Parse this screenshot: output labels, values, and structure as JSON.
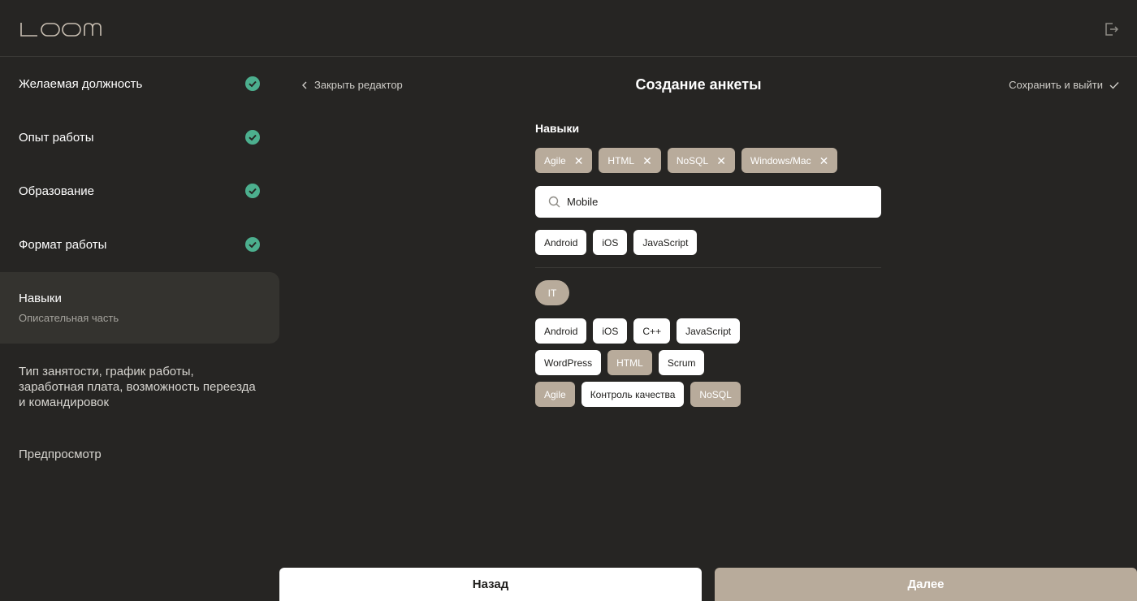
{
  "brand": {
    "logo_text": "LOOM"
  },
  "sidebar": {
    "steps": [
      {
        "label": "Желаемая должность",
        "done": true
      },
      {
        "label": "Опыт работы",
        "done": true
      },
      {
        "label": "Образование",
        "done": true
      },
      {
        "label": "Формат работы",
        "done": true
      },
      {
        "label": "Навыки",
        "sub": "Описательная часть",
        "active": true
      },
      {
        "label": "Тип занятости, график работы, заработная плата, возможность переезда и командировок"
      },
      {
        "label": "Предпросмотр"
      }
    ]
  },
  "header": {
    "close_editor": "Закрыть редактор",
    "title": "Создание анкеты",
    "save_exit": "Сохранить и выйти"
  },
  "skills": {
    "section_title": "Навыки",
    "selected": [
      "Agile",
      "HTML",
      "NoSQL",
      "Windows/Mac"
    ],
    "search": {
      "value": "Mobile",
      "placeholder": ""
    },
    "suggestions": [
      "Android",
      "iOS",
      "JavaScript"
    ],
    "category": "IT",
    "category_rows": [
      [
        {
          "label": "Android",
          "selected": false
        },
        {
          "label": "iOS",
          "selected": false
        },
        {
          "label": "C++",
          "selected": false
        },
        {
          "label": "JavaScript",
          "selected": false
        }
      ],
      [
        {
          "label": "WordPress",
          "selected": false
        },
        {
          "label": "HTML",
          "selected": true
        },
        {
          "label": "Scrum",
          "selected": false
        }
      ],
      [
        {
          "label": "Agile",
          "selected": true
        },
        {
          "label": "Контроль качества",
          "selected": false
        },
        {
          "label": "NoSQL",
          "selected": true
        }
      ]
    ]
  },
  "footer": {
    "back": "Назад",
    "next": "Далее"
  },
  "colors": {
    "background": "#262523",
    "accent": "#b8ab9b",
    "check": "#4caf8e"
  }
}
